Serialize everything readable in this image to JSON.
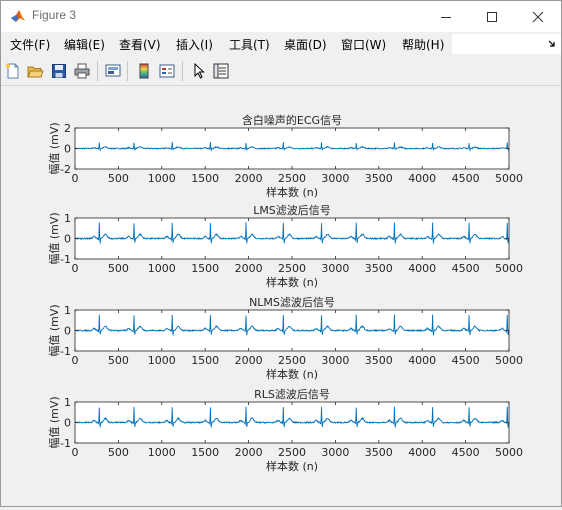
{
  "window": {
    "title": "Figure 3"
  },
  "menu": [
    "文件(F)",
    "编辑(E)",
    "查看(V)",
    "插入(I)",
    "工具(T)",
    "桌面(D)",
    "窗口(W)",
    "帮助(H)"
  ],
  "toolbar_icons": [
    "new-file-icon",
    "open-folder-icon",
    "save-icon",
    "print-icon",
    "link-plot-icon",
    "colorbar-icon",
    "legend-icon",
    "pointer-icon",
    "property-inspector-icon"
  ],
  "chart_data": [
    {
      "type": "line",
      "title": "含白噪声的ECG信号",
      "xlabel": "样本数 (n)",
      "ylabel": "幅值 (mV)",
      "xlim": [
        0,
        5000
      ],
      "ylim": [
        -2,
        2
      ],
      "xticks": [
        0,
        500,
        1000,
        1500,
        2000,
        2500,
        3000,
        3500,
        4000,
        4500,
        5000
      ],
      "yticks": [
        -2,
        0,
        2
      ],
      "beat_positions": [
        280,
        680,
        1120,
        1560,
        1970,
        2400,
        2840,
        3240,
        3680,
        4120,
        4540,
        4980
      ],
      "r_peak": 0.6,
      "s_trough": -0.15,
      "t_wave": 0.15,
      "noise_amplitude": 0.05,
      "color": "#0072BD"
    },
    {
      "type": "line",
      "title": "LMS滤波后信号",
      "xlabel": "样本数 (n)",
      "ylabel": "幅值 (mV)",
      "xlim": [
        0,
        5000
      ],
      "ylim": [
        -1,
        1
      ],
      "xticks": [
        0,
        500,
        1000,
        1500,
        2000,
        2500,
        3000,
        3500,
        4000,
        4500,
        5000
      ],
      "yticks": [
        -1,
        0,
        1
      ],
      "beat_positions": [
        280,
        680,
        1120,
        1560,
        1970,
        2400,
        2840,
        3240,
        3680,
        4120,
        4540,
        4980
      ],
      "r_peak": 0.8,
      "s_trough": -0.25,
      "t_wave": 0.2,
      "noise_amplitude": 0.03,
      "color": "#0072BD"
    },
    {
      "type": "line",
      "title": "NLMS滤波后信号",
      "xlabel": "样本数 (n)",
      "ylabel": "幅值 (mV)",
      "xlim": [
        0,
        5000
      ],
      "ylim": [
        -1,
        1
      ],
      "xticks": [
        0,
        500,
        1000,
        1500,
        2000,
        2500,
        3000,
        3500,
        4000,
        4500,
        5000
      ],
      "yticks": [
        -1,
        0,
        1
      ],
      "beat_positions": [
        280,
        680,
        1120,
        1560,
        1970,
        2400,
        2840,
        3240,
        3680,
        4120,
        4540,
        4980
      ],
      "r_peak": 0.8,
      "s_trough": -0.25,
      "t_wave": 0.2,
      "noise_amplitude": 0.03,
      "color": "#0072BD"
    },
    {
      "type": "line",
      "title": "RLS滤波后信号",
      "xlabel": "样本数 (n)",
      "ylabel": "幅值 (mV)",
      "xlim": [
        0,
        5000
      ],
      "ylim": [
        -1,
        1
      ],
      "xticks": [
        0,
        500,
        1000,
        1500,
        2000,
        2500,
        3000,
        3500,
        4000,
        4500,
        5000
      ],
      "yticks": [
        -1,
        0,
        1
      ],
      "beat_positions": [
        280,
        680,
        1120,
        1560,
        1970,
        2400,
        2840,
        3240,
        3680,
        4120,
        4540,
        4980
      ],
      "r_peak": 0.8,
      "s_trough": -0.25,
      "t_wave": 0.2,
      "noise_amplitude": 0.03,
      "color": "#0072BD"
    }
  ]
}
